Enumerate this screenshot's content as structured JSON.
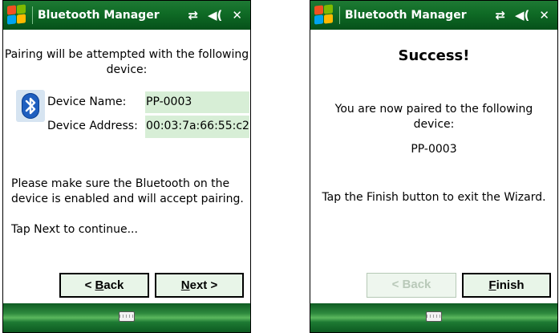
{
  "app_title": "Bluetooth Manager",
  "titlebar_icons": [
    "connectivity-icon",
    "volume-icon",
    "close-icon"
  ],
  "colors": {
    "titlebar": "#0f6a25",
    "value_highlight": "#d7eed6",
    "button_bg": "#e8f5e8",
    "bluetooth": "#1f5fbf"
  },
  "left_screen": {
    "intro": "Pairing will be attempted with the following device:",
    "device_name_label": "Device Name:",
    "device_name_value": "PP-0003",
    "device_address_label": "Device Address:",
    "device_address_value": "00:03:7a:66:55:c2",
    "instruction": "Please make sure the Bluetooth on the device is enabled and will accept pairing.",
    "continue_text": "Tap Next to continue...",
    "back_button": {
      "accel": "B",
      "rest": "ack",
      "prefix": "< "
    },
    "next_button": {
      "accel": "N",
      "rest": "ext",
      "suffix": " >"
    }
  },
  "right_screen": {
    "heading": "Success!",
    "paired_text": "You are now paired to the following device:",
    "device_name": "PP-0003",
    "finish_instruction": "Tap the Finish button to exit the Wizard.",
    "back_button": "< Back",
    "finish_button": {
      "accel": "F",
      "rest": "inish"
    }
  }
}
